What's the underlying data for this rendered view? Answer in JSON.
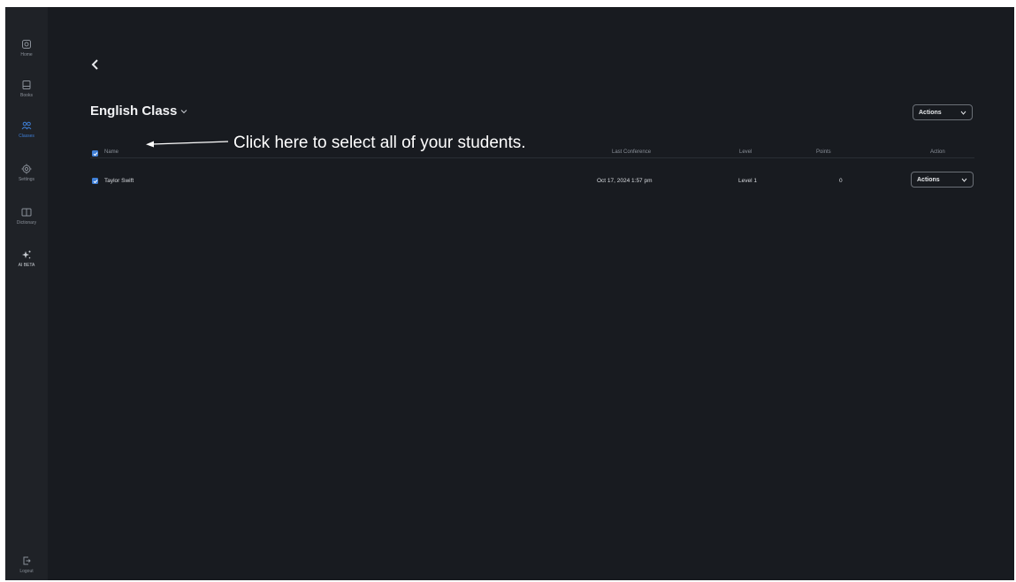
{
  "sidebar": {
    "items": [
      {
        "label": "Home",
        "icon": "home-icon"
      },
      {
        "label": "Books",
        "icon": "book-icon"
      },
      {
        "label": "Classes",
        "icon": "classes-icon"
      },
      {
        "label": "Settings",
        "icon": "gear-icon"
      },
      {
        "label": "Dictionary",
        "icon": "dictionary-icon"
      },
      {
        "label": "AI BETA",
        "icon": "ai-sparkle-icon"
      }
    ],
    "active": "Classes",
    "logout_label": "Logout"
  },
  "header": {
    "class_name": "English Class",
    "actions_label": "Actions"
  },
  "annotation": "Click here to select all of your students.",
  "table": {
    "columns": [
      "Name",
      "Last Conference",
      "Level",
      "Points",
      "Action"
    ],
    "select_all_checked": true,
    "rows": [
      {
        "checked": true,
        "name": "Taylor Swift",
        "last_conference": "Oct 17, 2024 1:57 pm",
        "level": "Level 1",
        "points": "0",
        "action_label": "Actions"
      }
    ]
  },
  "colors": {
    "accent": "#3f7fd6",
    "background": "#181b20",
    "sidebar": "#1f2227"
  }
}
